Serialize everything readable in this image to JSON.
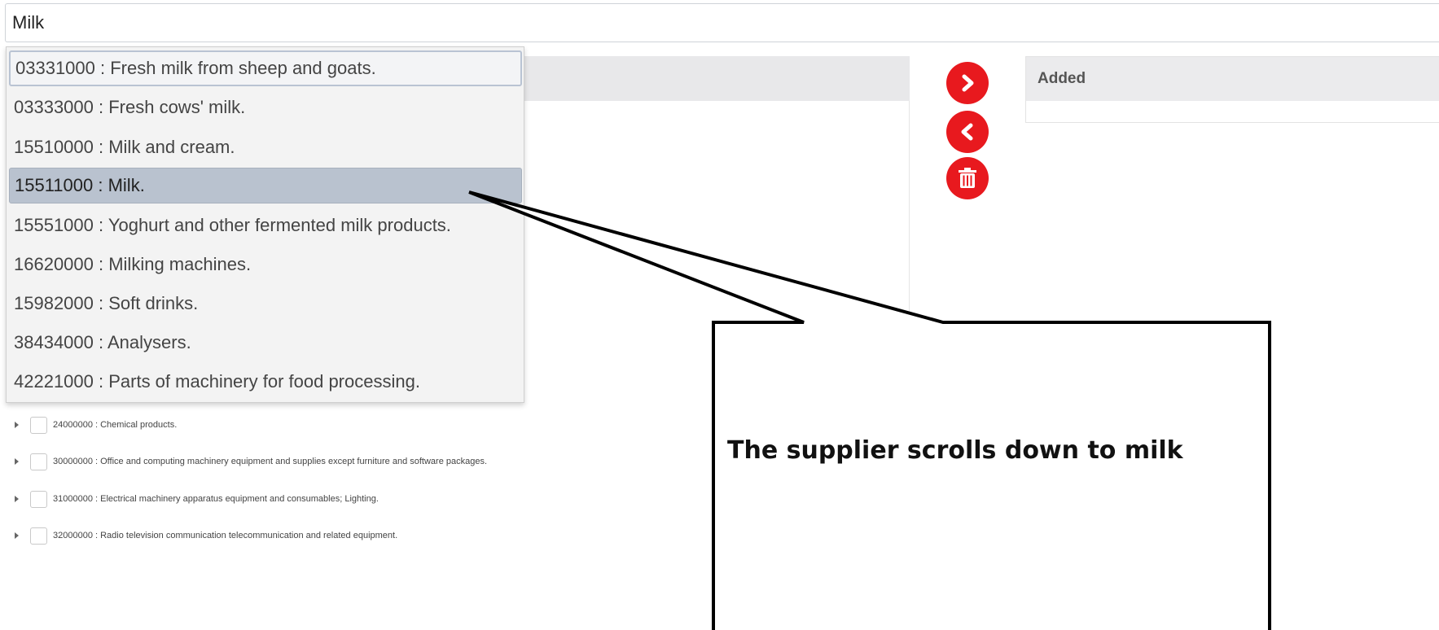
{
  "search": {
    "value": "Milk"
  },
  "dropdown": {
    "items": [
      "03331000 : Fresh milk from sheep and goats.",
      "03333000 : Fresh cows' milk.",
      "15510000 : Milk and cream.",
      "15511000 : Milk.",
      "15551000 : Yoghurt and other fermented milk products.",
      "16620000 : Milking machines.",
      "15982000 : Soft drinks.",
      "38434000 : Analysers.",
      "42221000 : Parts of machinery for food processing."
    ],
    "focused_index": 0,
    "selected_index": 3
  },
  "tree": {
    "rows": [
      "24000000 : Chemical products.",
      "30000000 : Office and computing machinery equipment and supplies except furniture and software packages.",
      "31000000 : Electrical machinery apparatus equipment and consumables; Lighting.",
      "32000000 : Radio television communication telecommunication and related equipment."
    ]
  },
  "actions": {
    "add_icon": "chevron-right-icon",
    "remove_icon": "chevron-left-icon",
    "delete_icon": "trash-icon",
    "color": "#e8191e"
  },
  "added_panel": {
    "header": "Added"
  },
  "callout": {
    "text": "The supplier scrolls down to milk"
  }
}
